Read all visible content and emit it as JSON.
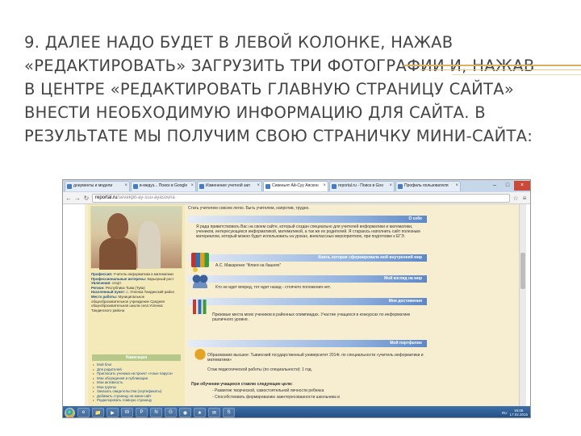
{
  "slide": {
    "title": "9. ДАЛЕЕ НАДО БУДЕТ В ЛЕВОЙ КОЛОНКЕ, НАЖАВ «РЕДАКТИРОВАТЬ» ЗАГРУЗИТЬ ТРИ ФОТОГРАФИИ И, НАЖАВ В ЦЕНТРЕ «РЕДАКТИРОВАТЬ ГЛАВНУЮ СТРАНИЦУ САЙТА» ВНЕСТИ НЕОБХОДИМУЮ ИНФОРМАЦИЮ ДЛЯ САЙТА. В РЕЗУЛЬТАТЕ МЫ ПОЛУЧИМ СВОЮ СТРАНИЧКУ МИНИ-САЙТА:"
  },
  "browser": {
    "tabs": [
      {
        "label": "документы и модели",
        "active": false
      },
      {
        "label": "в-медуз... Поиск в Google",
        "active": false
      },
      {
        "label": "Изменение учетной зап",
        "active": false
      },
      {
        "label": "Севеньят Ай-Суу Аяскон",
        "active": true
      },
      {
        "label": "reportal.ru - Поиск в Goo",
        "active": false
      },
      {
        "label": "Профиль пользователя",
        "active": false
      }
    ],
    "window_controls": {
      "minimize": "–",
      "maximize": "□",
      "close": "×"
    },
    "address": {
      "domain": "reportal.ru",
      "path": "/sevekpit-ay-suu-ayasovna"
    },
    "nav": {
      "back": "←",
      "forward": "→",
      "reload": "↻",
      "star": "☆",
      "menu": "≡"
    }
  },
  "site": {
    "profile": {
      "rows": [
        {
          "label": "Профессия:",
          "value": "Учитель информатики и математики"
        },
        {
          "label": "Профессиональные интересы:",
          "value": "Карьерный рост"
        },
        {
          "label": "Увлечения:",
          "value": "спорт"
        },
        {
          "label": "Регион:",
          "value": "Республика Тыва (Тува)"
        },
        {
          "label": "Населенный пункт:",
          "value": "с. Успенка Тандинский район"
        },
        {
          "label": "Место работы:",
          "value": "Муниципальное общеобразовательное учреждение Средняя общеобразовательная школа села Успенка Тандинского района"
        }
      ]
    },
    "navigation": {
      "heading": "Навигация",
      "items": [
        "Мой блог",
        "Для родителей",
        "Пригласить ученика на проект «Алые паруса»",
        "Мои обсуждения и публикации",
        "Мои активность",
        "Мои группы",
        "Заказать свидетельства (сертификаты)",
        "Добавить страницу на мини-сайт",
        "Редактировать главную страницу"
      ]
    },
    "main": {
      "intro": "Стать учителем совсем легко. Быть учителем, напротив, трудно.",
      "sections": [
        {
          "title": "О себе",
          "text": "Я рада приветствовать Вас на своем сайте, который создан специально для учителей информатики и математики, учеников, интересующихся информатикой, математикой, а так же их родителей. Я стараюсь наполнить сайт полезным материалом, который можно будет использовать на уроках, внеклассных мероприятиях, при подготовке к ЕГЭ."
        },
        {
          "title": "Книга, которая сформировала мой внутренний мир",
          "text": "А.С. Макаренко \"Флаги на башнях\""
        },
        {
          "title": "Мой взгляд на мир",
          "text": "Кто не идет вперед, тот идет назад - стоячего положения нет."
        },
        {
          "title": "Мои достижения",
          "text": "Призовые места моих учеников в районных олимпиадах. Участие учащихся в конкурсах по информатике различного уровня."
        },
        {
          "title": "Мой портфолио",
          "text_lines": [
            "Образование высшее: Тывинский государственный университет 2014г. по специальности «учитель информатики и математики»",
            "Стаж педагогической работы (по специальности): 1 год.",
            "При обучении учащихся ставлю следующие цели:",
            "- Развитие творческой, самостоятельной личности ребенка",
            "- Способствовать формированию заинтересованности школьника в"
          ]
        }
      ]
    }
  },
  "taskbar": {
    "apps": [
      "e",
      "📁",
      "▶",
      "W",
      "P",
      "N",
      "G",
      "◉",
      "★",
      "✉",
      "S"
    ],
    "language": "RU",
    "time": "16:09",
    "date": "17.02.2016"
  }
}
